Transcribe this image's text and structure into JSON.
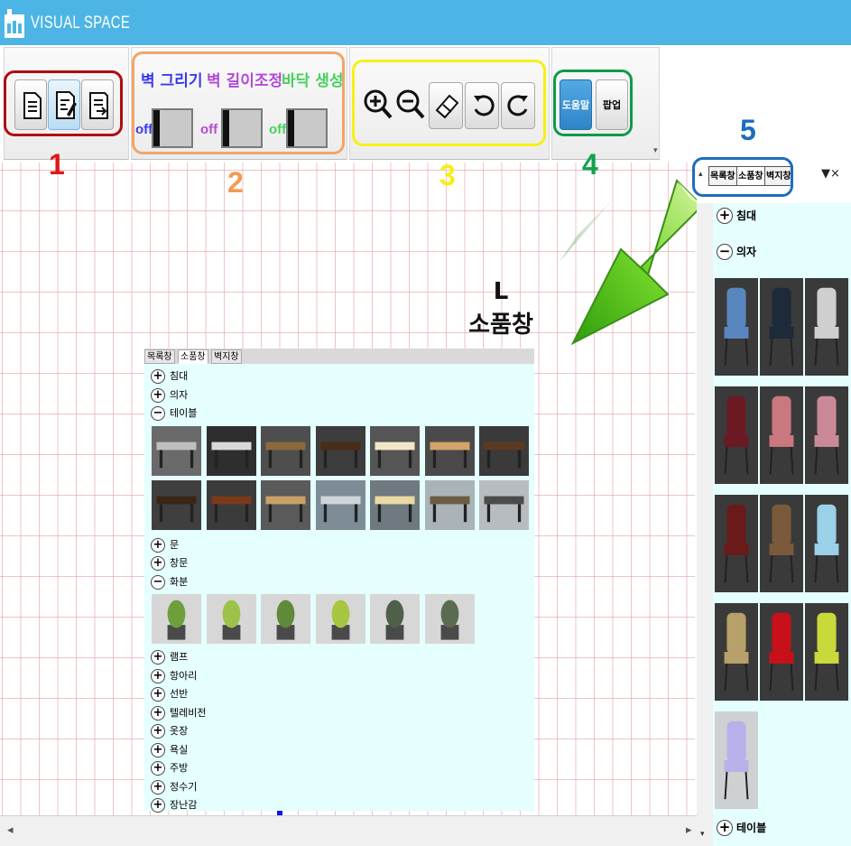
{
  "app": {
    "title": "VISUAL SPACE"
  },
  "ribbon": {
    "file_buttons": [
      "new-document-icon",
      "edit-document-icon",
      "export-document-icon"
    ],
    "modes": [
      {
        "label": "벽 그리기",
        "state": "off",
        "color": "#3a3aef"
      },
      {
        "label": "벽 길이조정",
        "state": "off",
        "color": "#b24ad8"
      },
      {
        "label": "바닥 생성",
        "state": "off",
        "color": "#46d25c"
      }
    ],
    "view_buttons": [
      "zoom-in-icon",
      "zoom-out-icon",
      "eraser-icon",
      "rotate-left-icon",
      "rotate-right-icon"
    ],
    "help_button": "도움말",
    "popup_button": "팝업",
    "annotations": [
      "1",
      "2",
      "3",
      "4",
      "5"
    ],
    "annotation_colors": [
      "#e0161b",
      "#f39a55",
      "#f6ee18",
      "#13a24e",
      "#1c6cc0"
    ]
  },
  "canvas": {
    "callout": {
      "line1": "L",
      "line2": "소품창"
    }
  },
  "inset_panel": {
    "tabs": [
      "목록창",
      "소품창",
      "벽지창"
    ],
    "active_tab": 1,
    "categories": [
      {
        "label": "침대",
        "expanded": false
      },
      {
        "label": "의자",
        "expanded": false
      },
      {
        "label": "테이블",
        "expanded": true
      },
      {
        "label": "문",
        "expanded": false
      },
      {
        "label": "창문",
        "expanded": false
      },
      {
        "label": "화분",
        "expanded": true
      },
      {
        "label": "램프",
        "expanded": false
      },
      {
        "label": "항아리",
        "expanded": false
      },
      {
        "label": "선반",
        "expanded": false
      },
      {
        "label": "텔레비전",
        "expanded": false
      },
      {
        "label": "옷장",
        "expanded": false
      },
      {
        "label": "욕실",
        "expanded": false
      },
      {
        "label": "주방",
        "expanded": false
      },
      {
        "label": "정수기",
        "expanded": false
      },
      {
        "label": "장난감",
        "expanded": false
      }
    ],
    "table_thumbs": [
      "round-glass-table",
      "black-cube-table",
      "low-coffee-table",
      "office-desk",
      "light-wood-table",
      "wood-desk",
      "dark-wood-table",
      "round-bar-table",
      "round-side-table",
      "shelf-table",
      "sofa-set",
      "dining-set-white",
      "bench-dining-set",
      "chair-dining-set"
    ],
    "plant_thumbs": [
      "cactus-pot",
      "bamboo-pot",
      "leafy-plant-pot",
      "grass-vase",
      "snake-plant",
      "tall-shrub"
    ]
  },
  "side_panel": {
    "tabs": [
      "목록창",
      "소품창",
      "벽지창"
    ],
    "active_tab": 1,
    "controls": "▼×",
    "categories_top": [
      {
        "label": "침대",
        "expanded": false
      },
      {
        "label": "의자",
        "expanded": true
      }
    ],
    "categories_bottom": [
      {
        "label": "테이블",
        "expanded": false
      }
    ],
    "chair_thumbs": [
      "blue-cushion-chair",
      "black-office-chair",
      "glass-chair",
      "red-office-chair",
      "pink-armchair",
      "pink-side-chair",
      "red-wood-chair",
      "brown-wood-chair",
      "blue-wing-chair",
      "wood-folding-chair",
      "red-curvy-chair",
      "yellow-sofa",
      "blue-beanbag"
    ]
  }
}
